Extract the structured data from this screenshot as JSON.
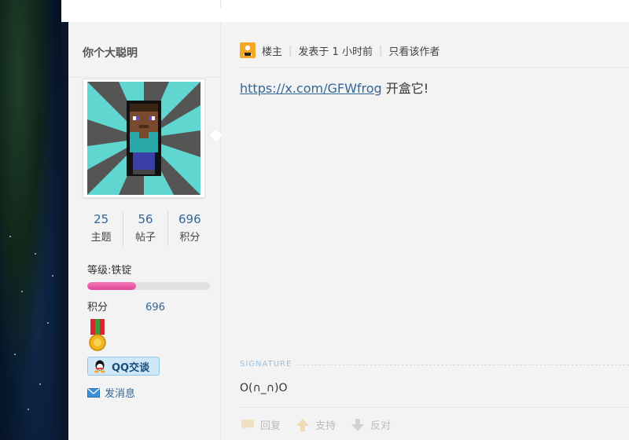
{
  "author": {
    "name": "你个大聪明",
    "stats": [
      {
        "value": "25",
        "label": "主题"
      },
      {
        "value": "56",
        "label": "帖子"
      },
      {
        "value": "696",
        "label": "积分"
      }
    ],
    "level_label": "等级:铁锭",
    "level_progress": 0.4,
    "credit_label": "积分",
    "credit_value": "696",
    "qq_label": "QQ交谈",
    "pm_label": "发消息"
  },
  "post": {
    "author_role": "楼主",
    "posted_time": "发表于 1 小时前",
    "only_author_label": "只看该作者",
    "url": "https://x.com/GFWfrog",
    "text": " 开盒它!",
    "signature_label": "SIGNATURE",
    "signature": "O(∩_∩)O",
    "actions": {
      "reply": "回复",
      "support": "支持",
      "oppose": "反对"
    }
  },
  "colors": {
    "accent": "#336699",
    "level_bar": "#e0449a",
    "qq_button": "#cfe8f7",
    "louzhu_badge": "#f5a623"
  },
  "icons": [
    "louzhu-icon",
    "medal-icon",
    "qq-icon",
    "mail-icon",
    "reply-icon",
    "thumb-up-icon",
    "thumb-down-icon"
  ]
}
